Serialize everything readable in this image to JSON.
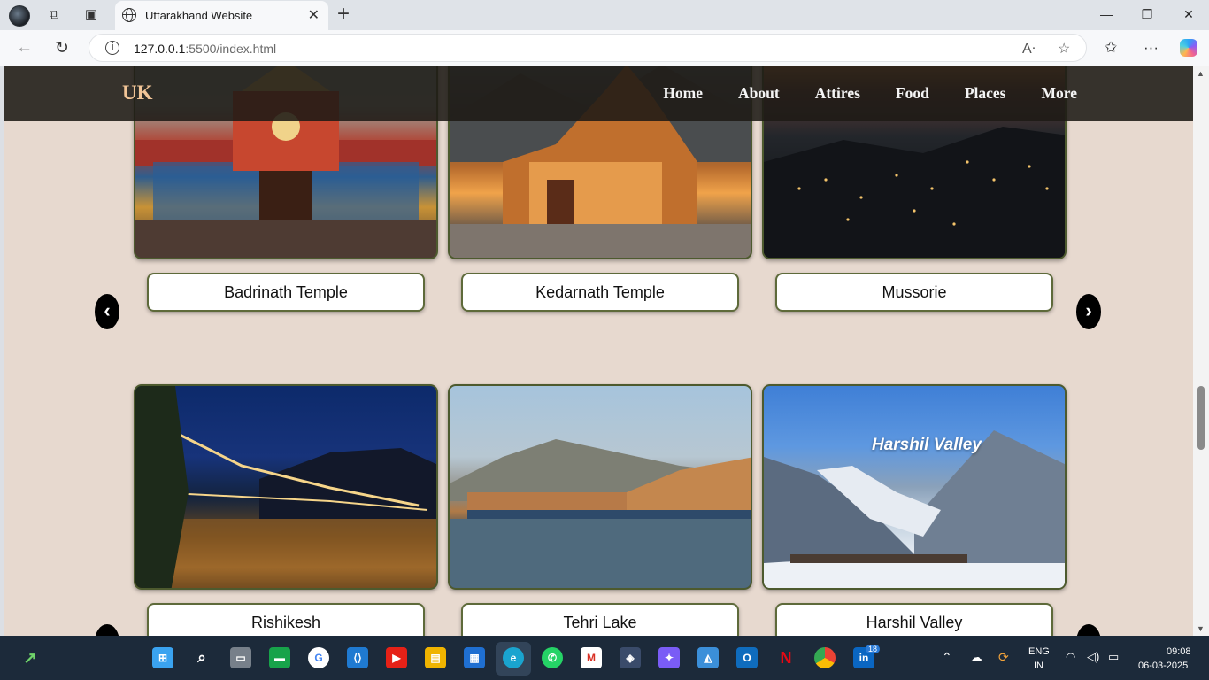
{
  "browser": {
    "tab_title": "Uttarakhand Website",
    "url_host": "127.0.0.1",
    "url_rest": ":5500/index.html"
  },
  "site": {
    "logo": "UK",
    "menu": [
      "Home",
      "About",
      "Attires",
      "Food",
      "Places",
      "More"
    ]
  },
  "places": {
    "row1": [
      {
        "name": "Badrinath Temple"
      },
      {
        "name": "Kedarnath Temple"
      },
      {
        "name": "Mussorie"
      }
    ],
    "row2": [
      {
        "name": "Rishikesh"
      },
      {
        "name": "Tehri Lake"
      },
      {
        "name": "Harshil Valley",
        "photo_caption": "Harshil Valley"
      }
    ],
    "prev_arrow": "‹",
    "next_arrow": "›"
  },
  "taskbar": {
    "language": "ENG",
    "region": "IN",
    "time": "09:08",
    "date": "06-03-2025",
    "linkedin_badge": "18"
  }
}
